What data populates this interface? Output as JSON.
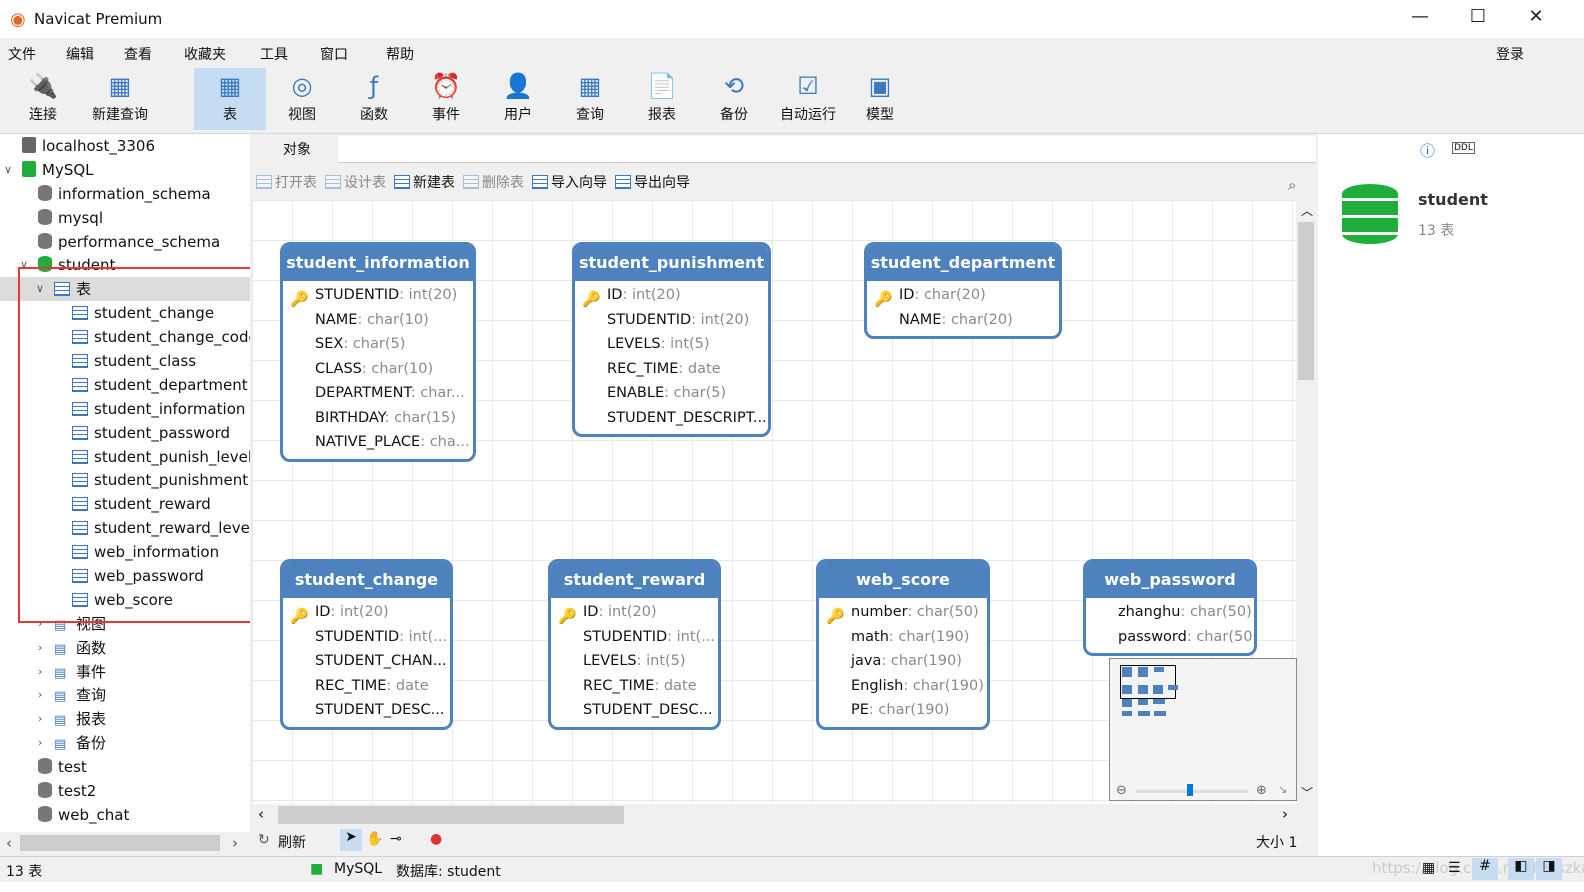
{
  "app": {
    "title": "Navicat Premium",
    "login": "登录"
  },
  "menu": [
    "文件",
    "编辑",
    "查看",
    "收藏夹",
    "工具",
    "窗口",
    "帮助"
  ],
  "toolbar": [
    {
      "label": "连接",
      "icon": "plug-icon"
    },
    {
      "label": "新建查询",
      "icon": "new-query-icon"
    },
    {
      "label": "表",
      "icon": "table-icon",
      "active": true
    },
    {
      "label": "视图",
      "icon": "view-icon"
    },
    {
      "label": "函数",
      "icon": "function-icon"
    },
    {
      "label": "事件",
      "icon": "clock-icon"
    },
    {
      "label": "用户",
      "icon": "user-icon"
    },
    {
      "label": "查询",
      "icon": "query-icon"
    },
    {
      "label": "报表",
      "icon": "report-icon"
    },
    {
      "label": "备份",
      "icon": "backup-icon"
    },
    {
      "label": "自动运行",
      "icon": "schedule-icon"
    },
    {
      "label": "模型",
      "icon": "model-icon"
    }
  ],
  "tree": [
    {
      "label": "localhost_3306",
      "level": 0,
      "type": "conn"
    },
    {
      "label": "MySQL",
      "level": 0,
      "type": "conn-green",
      "open": true
    },
    {
      "label": "information_schema",
      "level": 1,
      "type": "db"
    },
    {
      "label": "mysql",
      "level": 1,
      "type": "db"
    },
    {
      "label": "performance_schema",
      "level": 1,
      "type": "db"
    },
    {
      "label": "student",
      "level": 1,
      "type": "db-green",
      "open": true
    },
    {
      "label": "表",
      "level": 2,
      "type": "folder-table",
      "open": true,
      "selected": true
    },
    {
      "label": "student_change",
      "level": 3,
      "type": "table"
    },
    {
      "label": "student_change_code",
      "level": 3,
      "type": "table"
    },
    {
      "label": "student_class",
      "level": 3,
      "type": "table"
    },
    {
      "label": "student_department",
      "level": 3,
      "type": "table"
    },
    {
      "label": "student_information",
      "level": 3,
      "type": "table"
    },
    {
      "label": "student_password",
      "level": 3,
      "type": "table"
    },
    {
      "label": "student_punish_levels",
      "level": 3,
      "type": "table"
    },
    {
      "label": "student_punishment",
      "level": 3,
      "type": "table"
    },
    {
      "label": "student_reward",
      "level": 3,
      "type": "table"
    },
    {
      "label": "student_reward_level",
      "level": 3,
      "type": "table"
    },
    {
      "label": "web_information",
      "level": 3,
      "type": "table"
    },
    {
      "label": "web_password",
      "level": 3,
      "type": "table"
    },
    {
      "label": "web_score",
      "level": 3,
      "type": "table"
    },
    {
      "label": "视图",
      "level": 2,
      "type": "folder-view",
      "closed": true
    },
    {
      "label": "函数",
      "level": 2,
      "type": "folder-func",
      "closed": true
    },
    {
      "label": "事件",
      "level": 2,
      "type": "folder-event",
      "closed": true
    },
    {
      "label": "查询",
      "level": 2,
      "type": "folder-query",
      "closed": true
    },
    {
      "label": "报表",
      "level": 2,
      "type": "folder-report",
      "closed": true
    },
    {
      "label": "备份",
      "level": 2,
      "type": "folder-backup",
      "closed": true
    },
    {
      "label": "test",
      "level": 1,
      "type": "db"
    },
    {
      "label": "test2",
      "level": 1,
      "type": "db"
    },
    {
      "label": "web_chat",
      "level": 1,
      "type": "db"
    }
  ],
  "tab": "对象",
  "actions": [
    {
      "label": "打开表",
      "enabled": false
    },
    {
      "label": "设计表",
      "enabled": false
    },
    {
      "label": "新建表",
      "enabled": true
    },
    {
      "label": "删除表",
      "enabled": false
    },
    {
      "label": "导入向导",
      "enabled": true
    },
    {
      "label": "导出向导",
      "enabled": true
    }
  ],
  "er_tables": [
    {
      "name": "student_information",
      "fields": [
        {
          "n": "STUDENTID",
          "t": ": int(20)",
          "key": true
        },
        {
          "n": "NAME",
          "t": ": char(10)"
        },
        {
          "n": "SEX",
          "t": ": char(5)"
        },
        {
          "n": "CLASS",
          "t": ": char(10)"
        },
        {
          "n": "DEPARTMENT",
          "t": ": char..."
        },
        {
          "n": "BIRTHDAY",
          "t": ": char(15)"
        },
        {
          "n": "NATIVE_PLACE",
          "t": ": cha..."
        }
      ]
    },
    {
      "name": "student_punishment",
      "fields": [
        {
          "n": "ID",
          "t": ": int(20)",
          "key": true
        },
        {
          "n": "STUDENTID",
          "t": ": int(20)"
        },
        {
          "n": "LEVELS",
          "t": ": int(5)"
        },
        {
          "n": "REC_TIME",
          "t": ": date"
        },
        {
          "n": "ENABLE",
          "t": ": char(5)"
        },
        {
          "n": "STUDENT_DESCRIPT...",
          "t": ""
        }
      ]
    },
    {
      "name": "student_department",
      "fields": [
        {
          "n": "ID",
          "t": ": char(20)",
          "key": true
        },
        {
          "n": "NAME",
          "t": ": char(20)"
        }
      ]
    },
    {
      "name": "student_change",
      "fields": [
        {
          "n": "ID",
          "t": ": int(20)",
          "key": true
        },
        {
          "n": "STUDENTID",
          "t": ": int(..."
        },
        {
          "n": "STUDENT_CHAN...",
          "t": ""
        },
        {
          "n": "REC_TIME",
          "t": ": date"
        },
        {
          "n": "STUDENT_DESC...",
          "t": ""
        }
      ]
    },
    {
      "name": "student_reward",
      "fields": [
        {
          "n": "ID",
          "t": ": int(20)",
          "key": true
        },
        {
          "n": "STUDENTID",
          "t": ": int(..."
        },
        {
          "n": "LEVELS",
          "t": ": int(5)"
        },
        {
          "n": "REC_TIME",
          "t": ": date"
        },
        {
          "n": "STUDENT_DESC...",
          "t": ""
        }
      ]
    },
    {
      "name": "web_score",
      "fields": [
        {
          "n": "number",
          "t": ": char(50)",
          "key": true
        },
        {
          "n": "math",
          "t": ": char(190)"
        },
        {
          "n": "java",
          "t": ": char(190)"
        },
        {
          "n": "English",
          "t": ": char(190)"
        },
        {
          "n": "PE",
          "t": ": char(190)"
        }
      ]
    },
    {
      "name": "web_password",
      "fields": [
        {
          "n": "zhanghu",
          "t": ": char(50)"
        },
        {
          "n": "password",
          "t": ": char(50)"
        }
      ]
    }
  ],
  "bottom": {
    "refresh": "刷新",
    "size": "大小 1"
  },
  "right": {
    "name": "student",
    "count": "13 表"
  },
  "status": {
    "count": "13 表",
    "conn": "MySQL",
    "db": "数据库: student",
    "watermark": "https://blog.csdn.net/kzzszka"
  },
  "colors": {
    "accent": "#4d82bf",
    "highlight": "#e53935"
  }
}
